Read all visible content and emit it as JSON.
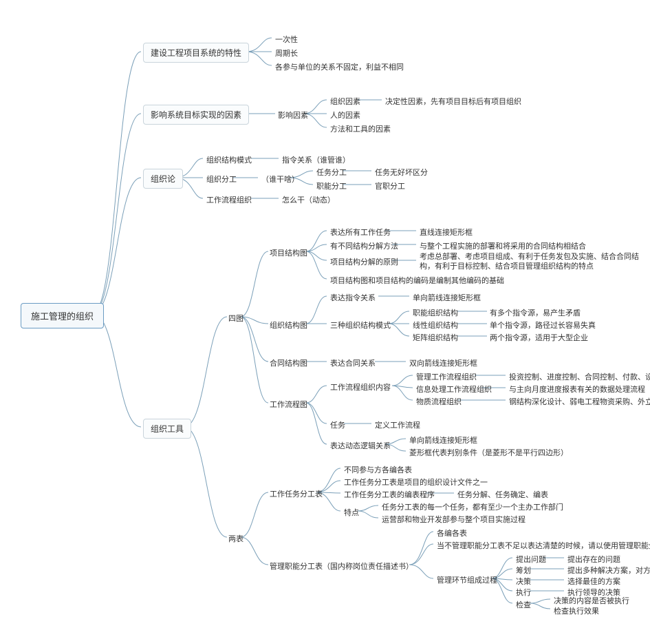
{
  "root": "施工管理的组织",
  "b1": {
    "title": "建设工程项目系统的特性",
    "c1": "一次性",
    "c2": "周期长",
    "c3": "各参与单位的关系不固定，利益不相同"
  },
  "b2": {
    "title": "影响系统目标实现的因素",
    "mid": "影响因素",
    "c1": "组织因素",
    "c1note": "决定性因素，先有项目目标后有项目组织",
    "c2": "人的因素",
    "c3": "方法和工具的因素"
  },
  "b3": {
    "title": "组织论",
    "c1": "组织结构模式",
    "c1note": "指令关系（谁管谁）",
    "c2": "组织分工",
    "c2note": "（谁干啥）",
    "c2a": "任务分工",
    "c2anote": "任务无好坏区分",
    "c2b": "职能分工",
    "c2bnote": "官职分工",
    "c3": "工作流程组织",
    "c3note": "怎么干（动态）"
  },
  "b4": {
    "title": "组织工具",
    "g1": {
      "title": "四图",
      "p1": {
        "title": "项目结构图",
        "a": "表达所有工作任务",
        "anote": "直线连接矩形框",
        "b": "有不同结构分解方法",
        "bnote": "与整个工程实施的部署和将采用的合同结构相结合",
        "c": "项目结构分解的原则",
        "cnote": "考虑总部署、考虑项目组成、有利于任务发包及实施、结合合同结构，有利于目标控制、结合项目管理组织结构的特点",
        "d": "项目结构图和项目结构的编码是编制其他编码的基础"
      },
      "p2": {
        "title": "组织结构图",
        "a": "表达指令关系",
        "anote": "单向箭线连接矩形框",
        "b": "三种组织结构模式",
        "b1": "职能组织结构",
        "b1note": "有多个指令源，易产生矛盾",
        "b2": "线性组织结构",
        "b2note": "单个指令源，路径过长容易失真",
        "b3": "矩阵组织结构",
        "b3note": "两个指令源，适用于大型企业"
      },
      "p3": {
        "title": "合同结构图",
        "a": "表达合同关系",
        "anote": "双向箭线连接矩形框"
      },
      "p4": {
        "title": "工作流程图",
        "a": "工作流程组织内容",
        "a1": "管理工作流程组织",
        "a1note": "投资控制、进度控制、合同控制、付款、设计变更、",
        "a2": "信息处理工作流程组织",
        "a2note": "与主向月度进度报表有关的数据处理流程",
        "a3": "物质流程组织",
        "a3note": "钢结构深化设计、弱电工程物资采购、外立面施工",
        "b": "任务",
        "bnote": "定义工作流程",
        "c": "表达动态逻辑关系",
        "c1": "单向箭线连接矩形框",
        "c2": "菱形框代表判别条件（是菱形不是平行四边形）"
      }
    },
    "g2": {
      "title": "两表",
      "p1": {
        "title": "工作任务分工表",
        "a": "不同参与方各编各表",
        "b": "工作任务分工表是项目的组织设计文件之一",
        "c": "工作任务分工表的编表程序",
        "cnote": "任务分解、任务确定、编表",
        "d": "特点",
        "d1": "任务分工表的每一个任务，都有至少一个主办工作部门",
        "d2": "运营部和物业开发部参与整个项目实施过程"
      },
      "p2": {
        "title": "管理职能分工表（国内称岗位责任描述书）",
        "a": "各编各表",
        "b": "当不管理职能分工表不足以表达清楚的时候，请以使用管理职能分工描述书",
        "c": "管理环节组成过程",
        "c1": "提出问题",
        "c1note": "提出存在的问题",
        "c2": "筹划",
        "c2note": "提出多种解决方案，对方案进行比较",
        "c3": "决策",
        "c3note": "选择最佳的方案",
        "c4": "执行",
        "c4note": "执行领导的决策",
        "c5": "检查",
        "c5a": "决策的内容是否被执行",
        "c5b": "检查执行效果"
      }
    }
  }
}
